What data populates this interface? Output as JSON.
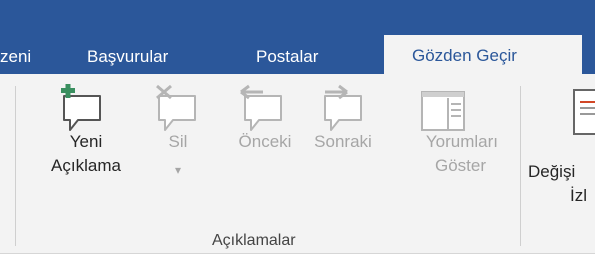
{
  "tabs": {
    "partial_left": "zeni",
    "basvurular": "Başvurular",
    "postalar": "Postalar",
    "gozden_gecir": "Gözden Geçir"
  },
  "group": {
    "label": "Açıklamalar",
    "buttons": {
      "yeni": {
        "line1": "Yeni",
        "line2": "Açıklama"
      },
      "sil": {
        "line1": "Sil",
        "dropdown": "▾"
      },
      "onceki": {
        "line1": "Önceki"
      },
      "sonraki": {
        "line1": "Sonraki"
      },
      "yorumlari": {
        "line1": "Yorumları",
        "line2": "Göster"
      }
    }
  },
  "next_group": {
    "partial_line1": "Değişi",
    "partial_line2": "İzl"
  },
  "colors": {
    "tabbar": "#2b579a",
    "ribbon": "#f3f3f3",
    "accent_green": "#3a8f5f",
    "disabled_text": "#a6a6a6"
  }
}
